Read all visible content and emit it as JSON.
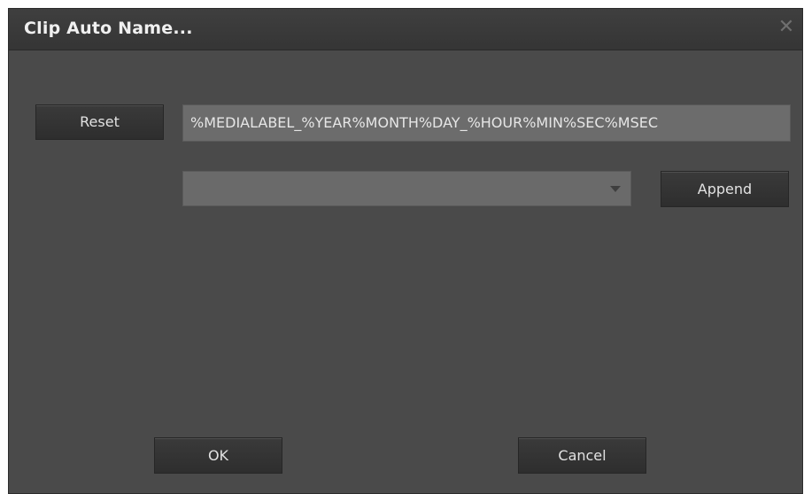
{
  "window": {
    "title": "Clip Auto Name...",
    "close_icon": "close-icon"
  },
  "reset_label": "Reset",
  "pattern": {
    "value": "%MEDIALABEL_%YEAR%MONTH%DAY_%HOUR%MIN%SEC%MSEC"
  },
  "token_select": {
    "selected": "",
    "icon": "chevron-down-icon"
  },
  "append_label": "Append",
  "footer": {
    "ok_label": "OK",
    "cancel_label": "Cancel"
  },
  "colors": {
    "dialog_bg": "#4a4a4a",
    "titlebar_bg": "#3a3a3a",
    "input_bg": "#6c6c6c",
    "button_bg": "#333333",
    "text": "#e6e6e6"
  }
}
